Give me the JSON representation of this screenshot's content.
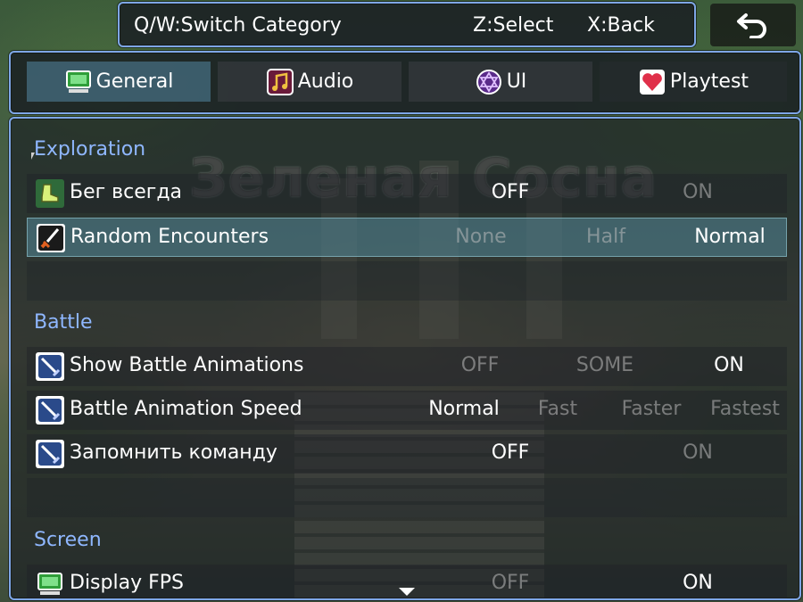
{
  "help": {
    "switch": "Q/W:Switch Category",
    "select": "Z:Select",
    "back": "X:Back"
  },
  "back_button": {
    "icon": "return-arrow-icon"
  },
  "tabs": [
    {
      "label": "General",
      "icon": "monitor-icon",
      "active": true
    },
    {
      "label": "Audio",
      "icon": "music-note-icon",
      "active": false
    },
    {
      "label": "UI",
      "icon": "hexagram-icon",
      "active": false
    },
    {
      "label": "Playtest",
      "icon": "heart-icon",
      "active": false
    }
  ],
  "watermark": "Зеленая Сосна",
  "sections": {
    "exploration": {
      "title": "Exploration",
      "rows": [
        {
          "label": "Бег всегда",
          "icon": "boot-icon",
          "options": [
            "OFF",
            "ON"
          ],
          "selected": "OFF"
        },
        {
          "label": "Random Encounters",
          "icon": "sword-icon",
          "options": [
            "None",
            "Half",
            "Normal"
          ],
          "selected": "Normal"
        }
      ]
    },
    "battle": {
      "title": "Battle",
      "rows": [
        {
          "label": "Show Battle Animations",
          "icon": "sword-icon",
          "options": [
            "OFF",
            "SOME",
            "ON"
          ],
          "selected": "ON"
        },
        {
          "label": "Battle Animation Speed",
          "icon": "sword-icon",
          "options": [
            "Normal",
            "Fast",
            "Faster",
            "Fastest"
          ],
          "selected": "Normal"
        },
        {
          "label": "Запомнить команду",
          "icon": "sword-icon",
          "options": [
            "OFF",
            "ON"
          ],
          "selected": "OFF"
        }
      ]
    },
    "screen": {
      "title": "Screen",
      "rows": [
        {
          "label": "Display FPS",
          "icon": "monitor-icon",
          "options": [
            "OFF",
            "ON"
          ],
          "selected": "ON"
        }
      ]
    }
  },
  "colors": {
    "window_border": "#7ea6e6",
    "category_text": "#8fb7ff",
    "selected_row": "#508291"
  }
}
